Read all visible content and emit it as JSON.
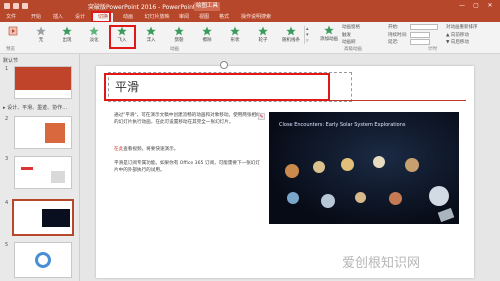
{
  "window": {
    "title": "突破版PowerPoint 2016 - PowerPoint",
    "context_tab": "绘图工具",
    "close_glyph": "✕",
    "min_glyph": "—",
    "max_glyph": "▢"
  },
  "tabs": [
    "文件",
    "开始",
    "插入",
    "设计",
    "切换",
    "动画",
    "幻灯片放映",
    "审阅",
    "视图",
    "格式",
    "操作说明搜索"
  ],
  "active_tab_index": 4,
  "ribbon": {
    "effects": [
      {
        "label": "无",
        "icon": "star-gray-icon"
      },
      {
        "label": "出现",
        "icon": "star-green-icon"
      },
      {
        "label": "淡化",
        "icon": "star-green-icon"
      },
      {
        "label": "飞入",
        "icon": "star-green-icon"
      },
      {
        "label": "浮入",
        "icon": "star-green-icon"
      },
      {
        "label": "劈裂",
        "icon": "star-green-icon"
      },
      {
        "label": "擦除",
        "icon": "star-green-icon"
      },
      {
        "label": "形状",
        "icon": "star-green-icon"
      },
      {
        "label": "轮子",
        "icon": "star-green-icon"
      },
      {
        "label": "随机线条",
        "icon": "star-green-icon"
      }
    ],
    "preview_group": "预览",
    "animation_group": "动画",
    "advanced": {
      "add_animation": "添加动画",
      "animation_pane": "动画窗格",
      "trigger": "触发",
      "painter": "动画刷"
    },
    "advanced_group": "高级动画",
    "timing": {
      "start": "开始:",
      "duration": "持续时间:",
      "delay": "延迟:",
      "reorder": "对动画重新排序",
      "move_earlier": "▲ 向前移动",
      "move_later": "▼ 向后移动"
    },
    "timing_group": "计时"
  },
  "slides_panel": {
    "section_default": "默认节",
    "section2": "▸ 设计、平滑、墨迹、协作…",
    "thumbs": [
      {
        "num": "1"
      },
      {
        "num": "2"
      },
      {
        "num": "3"
      },
      {
        "num": "4"
      },
      {
        "num": "5"
      }
    ]
  },
  "slide": {
    "title": "平滑",
    "paragraph1": "通过\"平滑\"，可在演示文稿中创建流畅的动画和对象移动。使用两张相似的幻灯片执行动画，在此可设置移动在其完全一张幻灯片。",
    "paragraph2_red": "在此",
    "paragraph2": "查看视频，将要快速演示。",
    "paragraph3": "平滑是订阅专属功能。如果你有 Office 365 订阅，可能需要下一张幻灯片中的外部执行的试用。",
    "picture_title": "Close Encounters: Early Solar System Explorations"
  },
  "colors": {
    "accent": "#b7472a",
    "highlight": "#e01818",
    "slide_red": "#c0392b"
  },
  "watermark": "爱创根知识网"
}
